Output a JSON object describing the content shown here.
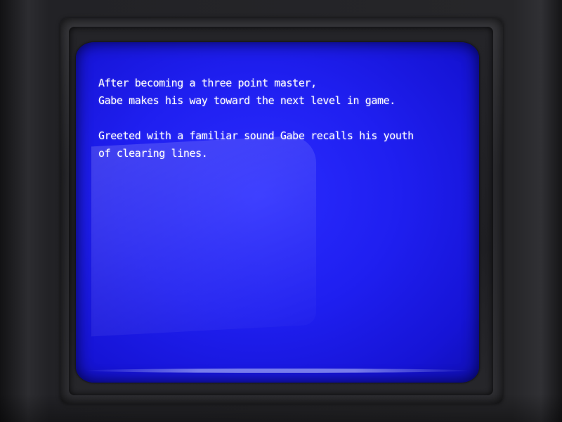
{
  "scene": {
    "screen_color": "#1f1ff0",
    "text_color": "#ffffff"
  },
  "dialog": {
    "paragraph1": {
      "line1": "After becoming a three point master,",
      "line2": "Gabe makes his way toward the next level in game."
    },
    "paragraph2": {
      "line1": "Greeted with a familiar sound Gabe recalls his youth",
      "line2": "of clearing lines."
    }
  }
}
